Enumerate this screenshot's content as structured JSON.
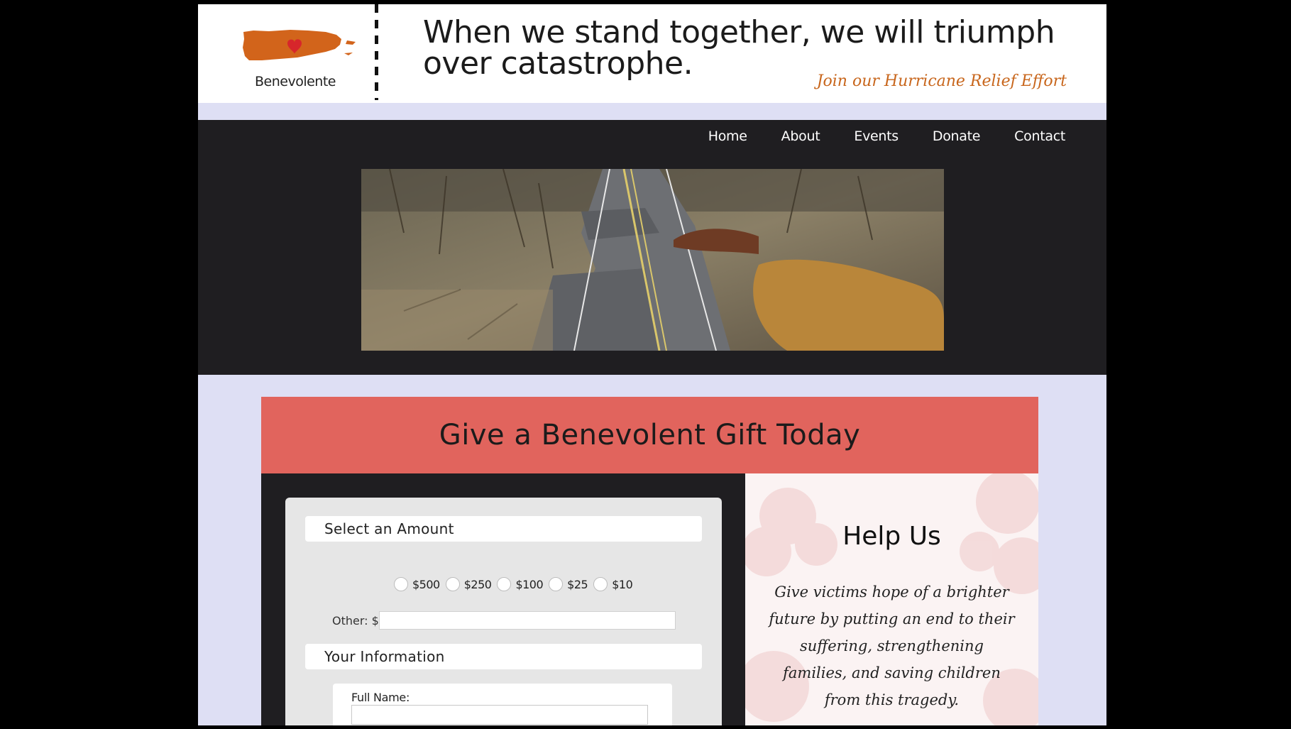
{
  "header": {
    "logo_text": "Benevolente",
    "tagline": "When we stand together, we will triumph over catastrophe.",
    "relief_link": "Join our Hurricane Relief Effort"
  },
  "nav": {
    "items": [
      "Home",
      "About",
      "Events",
      "Donate",
      "Contact"
    ]
  },
  "donate": {
    "title": "Give a Benevolent Gift Today",
    "select_amount_heading": "Select an Amount",
    "amounts": [
      "$500",
      "$250",
      "$100",
      "$25",
      "$10"
    ],
    "other_label": "Other: $",
    "other_value": "",
    "info_heading": "Your Information",
    "full_name_label": "Full Name:",
    "full_name_value": ""
  },
  "help": {
    "title": "Help Us",
    "body": "Give victims hope of a brighter future by putting an end to their suffering, strengthening families, and saving children from this tragedy."
  },
  "colors": {
    "page_bg": "#dedff4",
    "dark": "#1f1e21",
    "accent_orange": "#d2641b",
    "coral": "#e1645d",
    "heart": "#d7262b"
  },
  "icons": [
    "puerto-rico-heart-logo-icon"
  ]
}
